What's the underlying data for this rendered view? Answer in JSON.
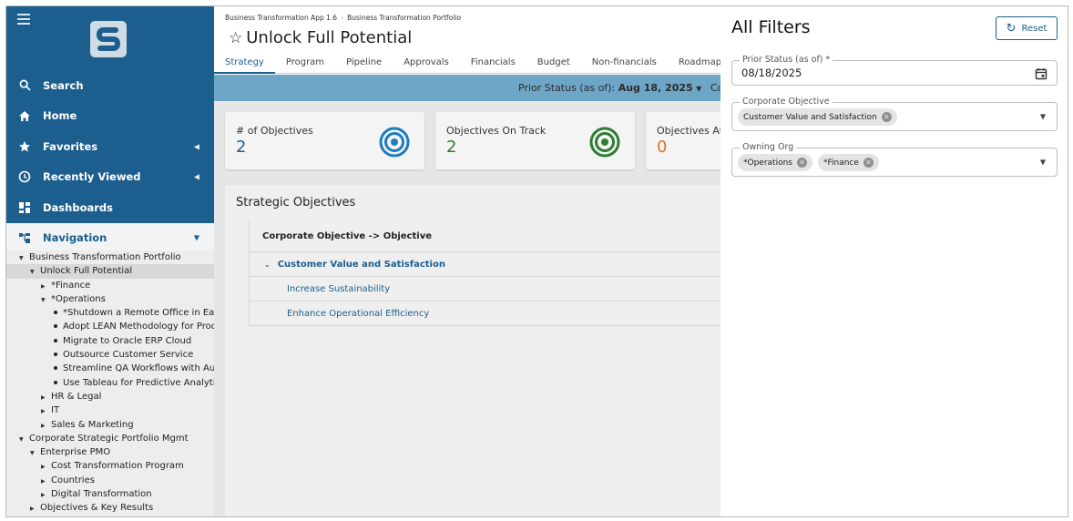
{
  "sidebar": {
    "nav": [
      {
        "label": "Search",
        "icon": "search-icon"
      },
      {
        "label": "Home",
        "icon": "home-icon"
      },
      {
        "label": "Favorites",
        "icon": "star-icon"
      },
      {
        "label": "Recently Viewed",
        "icon": "clock-icon"
      },
      {
        "label": "Dashboards",
        "icon": "dashboard-icon"
      },
      {
        "label": "Navigation",
        "icon": "navigation-icon"
      }
    ],
    "tree": [
      "Business Transformation Portfolio",
      "Unlock Full Potential",
      "*Finance",
      "*Operations",
      "*Shutdown a Remote Office in Eac...",
      "Adopt LEAN Methodology for Prod...",
      "Migrate to Oracle ERP Cloud",
      "Outsource Customer Service",
      "Streamline QA Workflows with Aut...",
      "Use Tableau for Predictive Analytics",
      "HR & Legal",
      "IT",
      "Sales & Marketing",
      "Corporate Strategic Portfolio Mgmt",
      "Enterprise PMO",
      "Cost Transformation Program",
      "Countries",
      "Digital Transformation",
      "Objectives & Key Results"
    ]
  },
  "header": {
    "breadcrumb_app": "Business Transformation App 1.6",
    "breadcrumb_sep": "›",
    "breadcrumb_portfolio": "Business Transformation Portfolio",
    "title": "Unlock Full Potential"
  },
  "tabs": [
    "Strategy",
    "Program",
    "Pipeline",
    "Approvals",
    "Financials",
    "Budget",
    "Non-financials",
    "Roadmap"
  ],
  "status_bar": {
    "prefix": "Prior Status (as of): ",
    "date": "Aug 18, 2025",
    "suffix": "Corpo"
  },
  "cards": [
    {
      "label": "# of Objectives",
      "value": "2",
      "color": "#1c5f8f"
    },
    {
      "label": "Objectives On Track",
      "value": "2",
      "color": "#2e7d32"
    },
    {
      "label": "Objectives At",
      "value": "0",
      "color": "#e0702a"
    }
  ],
  "objectives": {
    "title": "Strategic Objectives",
    "column_header": "Corporate Objective -> Objective",
    "group": "Customer Value and Satisfaction",
    "items": [
      "Increase Sustainability",
      "Enhance Operational Efficiency"
    ]
  },
  "filters": {
    "title": "All Filters",
    "reset_label": "Reset",
    "prior_status_label": "Prior Status (as of) *",
    "prior_status_value": "08/18/2025",
    "corporate_objective_label": "Corporate Objective",
    "corporate_objective_chips": [
      "Customer Value and Satisfaction"
    ],
    "owning_org_label": "Owning Org",
    "owning_org_chips": [
      "*Operations",
      "*Finance"
    ]
  },
  "colors": {
    "sidebar": "#1c5f8f",
    "accent": "#1c5f8f"
  }
}
